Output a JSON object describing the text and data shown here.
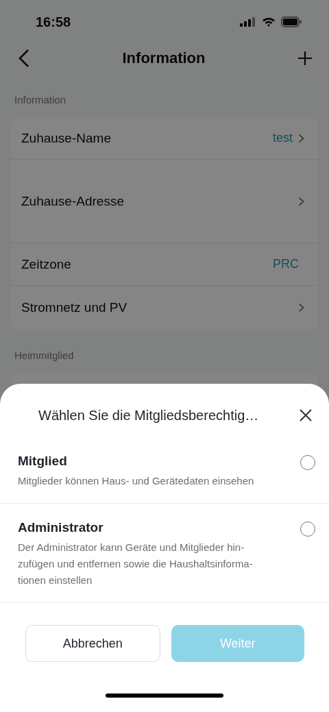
{
  "status_bar": {
    "time": "16:58"
  },
  "nav": {
    "title": "Information"
  },
  "sections": [
    {
      "label": "Information",
      "rows": [
        {
          "label": "Zuhause-Name",
          "value": "test",
          "chevron": true,
          "tall": false
        },
        {
          "label": "Zuhause-Adresse",
          "chevron": true,
          "tall": true
        },
        {
          "label": "Zeitzone",
          "value": "PRC",
          "chevron": false,
          "tall": false
        },
        {
          "label": "Stromnetz und PV",
          "chevron": true,
          "tall": false
        }
      ]
    },
    {
      "label": "Heimmitglied"
    }
  ],
  "sheet": {
    "title": "Wählen Sie die Mitgliedsberechtig…",
    "options": [
      {
        "title": "Mitglied",
        "description": "Mitglieder können Haus- und Gerätedaten einsehen",
        "selected": false
      },
      {
        "title": "Administrator",
        "description": "Der Administrator kann Geräte und Mitglieder hin-\nzufügen und entfernen sowie die Haushaltsinforma-\ntionen einstellen",
        "selected": false
      }
    ],
    "buttons": [
      {
        "label": "Abbrechen",
        "kind": "secondary",
        "disabled": false
      },
      {
        "label": "Weiter",
        "kind": "primary",
        "disabled": true
      }
    ]
  }
}
